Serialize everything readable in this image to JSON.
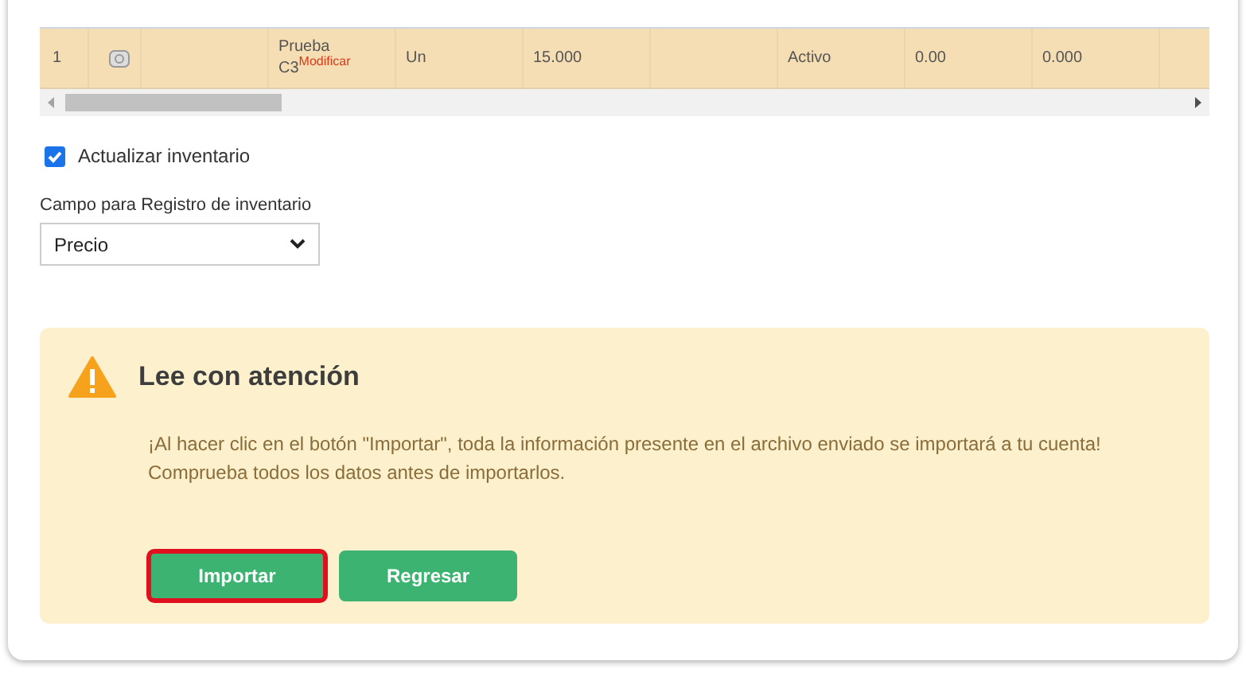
{
  "table": {
    "rows": [
      {
        "cells": [
          "1",
          "",
          "",
          "Prueba C3",
          "Un",
          "15.000",
          "",
          "Activo",
          "0.00",
          "0.000",
          ""
        ],
        "tag": "Modificar"
      }
    ]
  },
  "update_inventory": {
    "label": "Actualizar inventario",
    "checked": true
  },
  "register_field": {
    "label": "Campo para Registro de inventario",
    "value": "Precio"
  },
  "alert": {
    "title": "Lee con atención",
    "lines": [
      "¡Al hacer clic en el botón \"Importar\", toda la información presente en el archivo enviado se importará a tu cuenta!",
      "Comprueba todos los datos antes de importarlos."
    ]
  },
  "buttons": [
    {
      "label": "Importar",
      "focused": true
    },
    {
      "label": "Regresar",
      "focused": false
    }
  ]
}
